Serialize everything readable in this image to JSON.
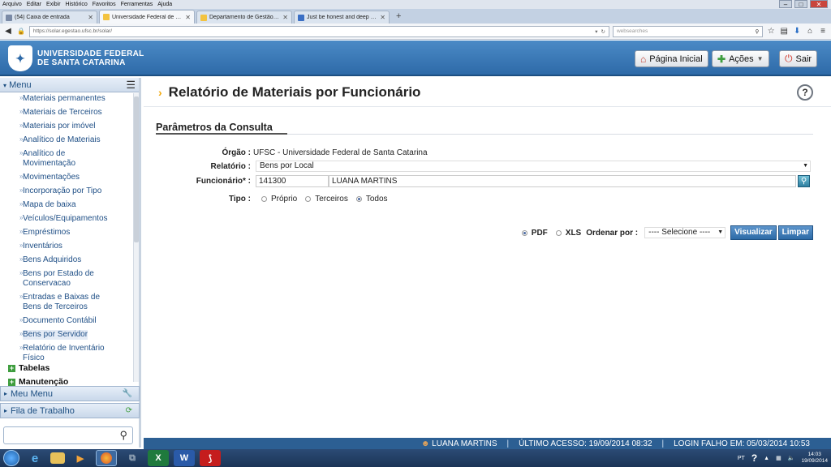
{
  "browser": {
    "menubar": [
      "Arquivo",
      "Editar",
      "Exibir",
      "Histórico",
      "Favoritos",
      "Ferramentas",
      "Ajuda"
    ],
    "window_title": "",
    "tabs": [
      {
        "label": "(54) Caixa de entrada",
        "active": false
      },
      {
        "label": "Universidade Federal de Sa...",
        "active": true
      },
      {
        "label": "Departamento de Gestão P...",
        "active": false
      },
      {
        "label": "Just be honest and deep de...",
        "active": false
      }
    ],
    "new_tab": "+",
    "url": "https://solar.egestao.ufsc.br/solar/",
    "search_placeholder": "websearches"
  },
  "header": {
    "logo_line1": "UNIVERSIDADE FEDERAL",
    "logo_line2": "DE SANTA CATARINA",
    "home_button": "Página Inicial",
    "actions_button": "Ações",
    "exit_button": "Sair"
  },
  "sidebar": {
    "menu_title": "Menu",
    "items": [
      "Materiais permanentes",
      "Materiais de Terceiros",
      "Materiais por imóvel",
      "Analítico de Materiais",
      "Analítico de Movimentação",
      "Movimentações",
      "Incorporação por Tipo",
      "Mapa de baixa",
      "Veículos/Equipamentos",
      "Empréstimos",
      "Inventários",
      "Bens Adquiridos",
      "Bens por Estado de Conservacao",
      "Entradas e Baixas de Bens de Terceiros",
      "Documento Contábil",
      "Bens por Servidor",
      "Relatório de Inventário Físico"
    ],
    "selected_item": "Bens por Servidor",
    "sections": [
      "Tabelas",
      "Manutenção"
    ],
    "panels": [
      "Meu Menu",
      "Fila de Trabalho"
    ],
    "search_value": ""
  },
  "main": {
    "page_title": "Relatório de Materiais por Funcionário",
    "help": "?",
    "section_title": "Parâmetros da Consulta",
    "orgao_label": "Órgão :",
    "orgao_value": "UFSC - Universidade Federal de Santa Catarina",
    "relatorio_label": "Relatório :",
    "relatorio_value": "Bens por Local",
    "funcionario_label": "Funcionário* :",
    "funcionario_code": "141300",
    "funcionario_name": "LUANA MARTINS",
    "tipo_label": "Tipo :",
    "tipo_options": [
      "Próprio",
      "Terceiros",
      "Todos"
    ],
    "tipo_selected": "Todos",
    "format_options": [
      "PDF",
      "XLS"
    ],
    "format_selected": "PDF",
    "ordenar_label": "Ordenar por :",
    "ordenar_value": "---- Selecione ----",
    "visualizar_button": "Visualizar",
    "limpar_button": "Limpar"
  },
  "statusbar": {
    "user": "LUANA MARTINS",
    "ultimo_acesso": "ÚLTIMO ACESSO: 19/09/2014 08:32",
    "login_falho": "LOGIN FALHO EM: 05/03/2014 10:53"
  },
  "taskbar": {
    "language": "PT",
    "time": "14:03",
    "date": "19/09/2014"
  }
}
